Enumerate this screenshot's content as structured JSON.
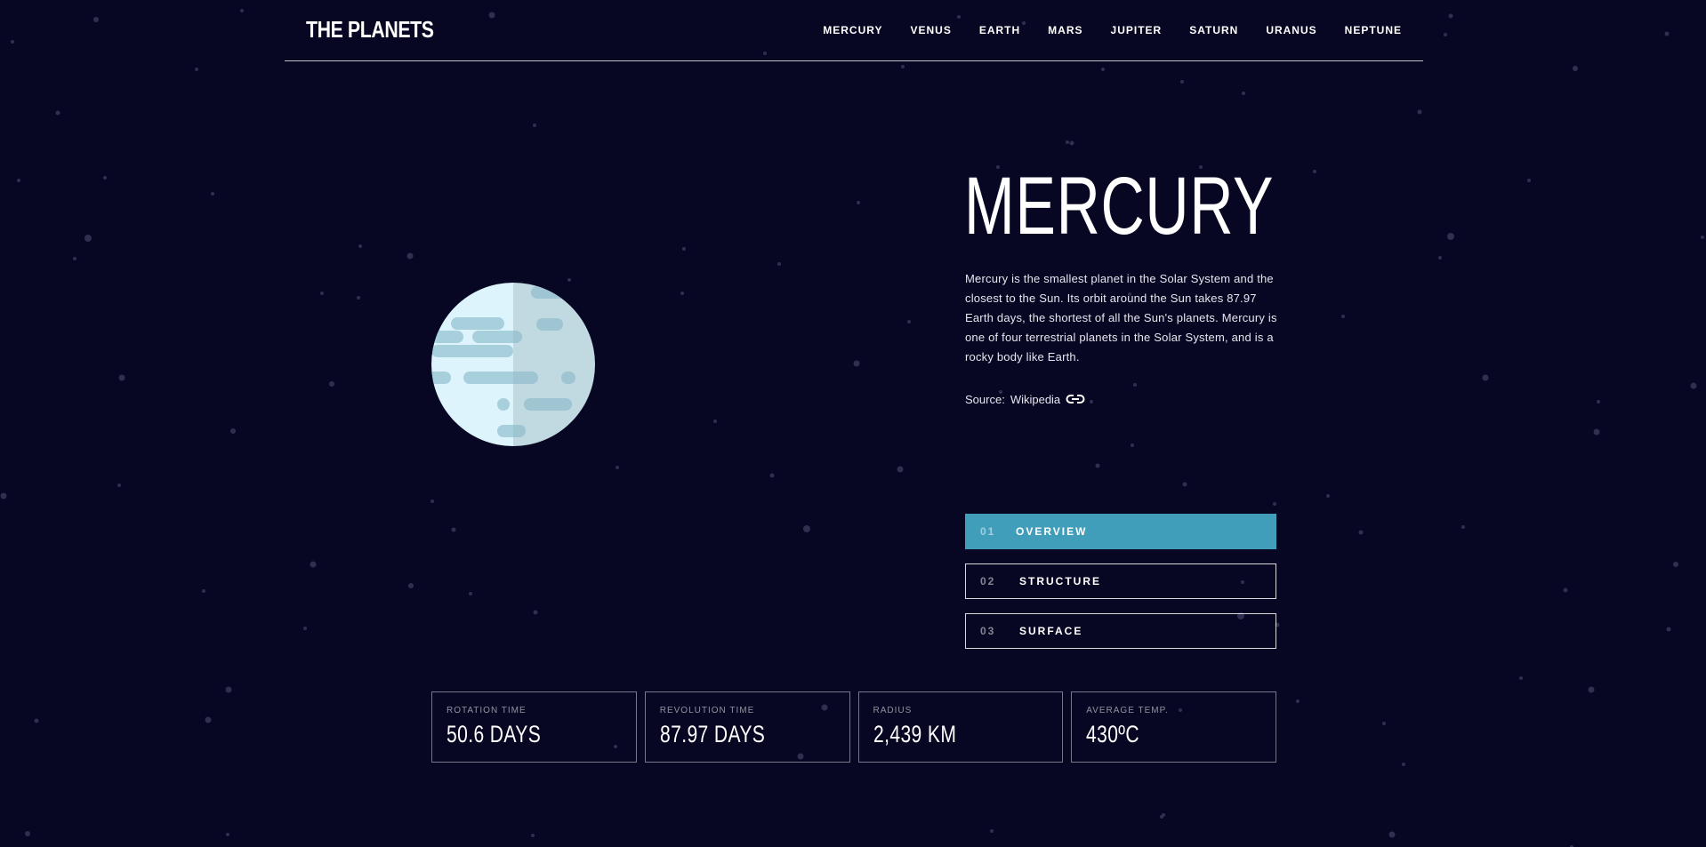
{
  "header": {
    "logo": "THE PLANETS",
    "nav": [
      "MERCURY",
      "VENUS",
      "EARTH",
      "MARS",
      "JUPITER",
      "SATURN",
      "URANUS",
      "NEPTUNE"
    ]
  },
  "planet": {
    "name": "MERCURY",
    "description": "Mercury is the smallest planet in the Solar System and the closest to the Sun. Its orbit around the Sun takes 87.97 Earth days, the shortest of all the Sun's planets. Mercury is one of four terrestrial planets in the Solar System, and is a rocky body like Earth.",
    "source_prefix": "Source:",
    "source_link": "Wikipedia"
  },
  "tabs": [
    {
      "num": "01",
      "label": "OVERVIEW",
      "active": true
    },
    {
      "num": "02",
      "label": "STRUCTURE",
      "active": false
    },
    {
      "num": "03",
      "label": "SURFACE",
      "active": false
    }
  ],
  "stats": [
    {
      "label": "ROTATION TIME",
      "value": "50.6 DAYS"
    },
    {
      "label": "REVOLUTION TIME",
      "value": "87.97 DAYS"
    },
    {
      "label": "RADIUS",
      "value": "2,439 KM"
    },
    {
      "label": "AVERAGE TEMP.",
      "value": "430ºC"
    }
  ],
  "colors": {
    "background": "#070724",
    "accent": "#419ebb",
    "planet_light": "#def4fc",
    "planet_spots": "#a8cfdc"
  },
  "icons": {
    "planet": "mercury-planet-icon",
    "source": "link-icon"
  }
}
